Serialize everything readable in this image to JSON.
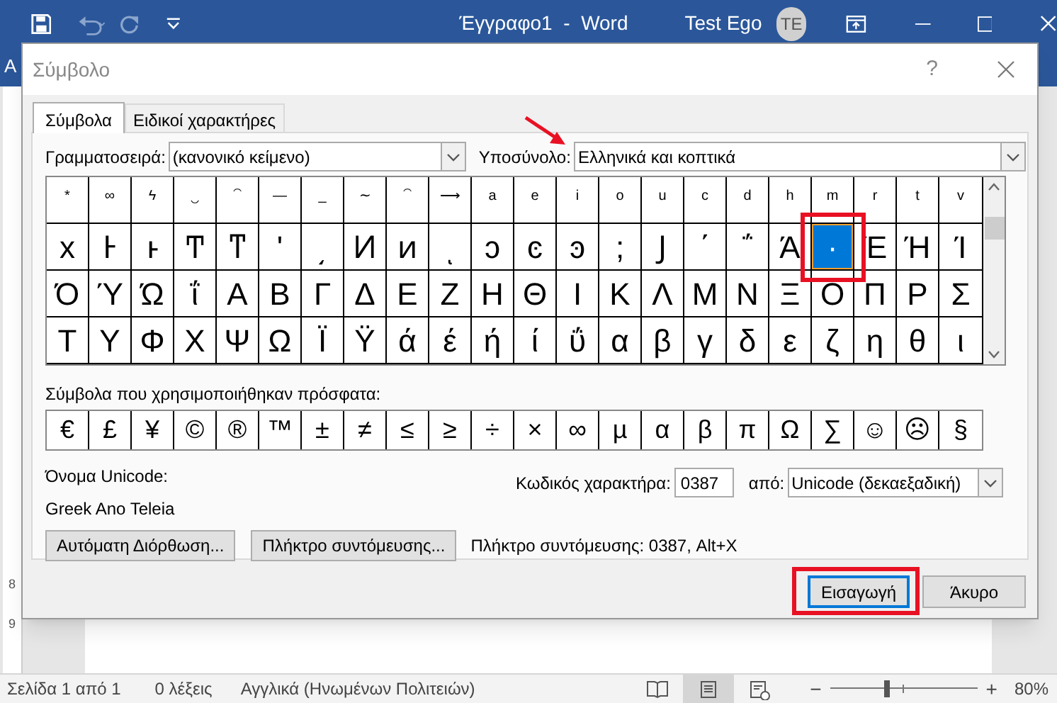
{
  "app": {
    "title": "Έγγραφο1  -  Word",
    "user": "Test Ego",
    "avatar": "TE",
    "ribbon_fragment": "A",
    "ruler_marks": [
      "8",
      "9"
    ]
  },
  "dialog": {
    "title": "Σύμβολο",
    "help": "?",
    "tabs": [
      {
        "label": "Σύμβολα",
        "selected": true
      },
      {
        "label": "Ειδικοί χαρακτήρες",
        "selected": false
      }
    ],
    "font": {
      "label": "Γραμματοσειρά:",
      "value": "(κανονικό κείμενο)"
    },
    "subset": {
      "label": "Υποσύνολο:",
      "value": "Ελληνικά και κοπτικά"
    },
    "grid": {
      "rows": [
        {
          "kind": "marks",
          "cells": [
            {
              "char": "*",
              "selected": false
            },
            {
              "char": "∞",
              "selected": false
            },
            {
              "char": "ϟ",
              "selected": false
            },
            {
              "char": "‿",
              "selected": false
            },
            {
              "char": "⁀",
              "selected": false
            },
            {
              "char": "—",
              "selected": false
            },
            {
              "char": "_",
              "selected": false
            },
            {
              "char": "∼",
              "selected": false
            },
            {
              "char": "⁀",
              "selected": false
            },
            {
              "char": "⟶",
              "selected": false
            },
            {
              "char": "a",
              "selected": false
            },
            {
              "char": "e",
              "selected": false
            },
            {
              "char": "i",
              "selected": false
            },
            {
              "char": "o",
              "selected": false
            },
            {
              "char": "u",
              "selected": false
            },
            {
              "char": "c",
              "selected": false
            },
            {
              "char": "d",
              "selected": false
            },
            {
              "char": "h",
              "selected": false
            },
            {
              "char": "m",
              "selected": false
            },
            {
              "char": "r",
              "selected": false
            },
            {
              "char": "t",
              "selected": false
            },
            {
              "char": "v",
              "selected": false
            }
          ]
        },
        {
          "kind": "chars",
          "cells": [
            {
              "char": "x",
              "selected": false
            },
            {
              "char": "Ͱ",
              "selected": false
            },
            {
              "char": "ͱ",
              "selected": false
            },
            {
              "char": "Ͳ",
              "selected": false
            },
            {
              "char": "ͳ",
              "selected": false
            },
            {
              "char": "ʹ",
              "selected": false
            },
            {
              "char": "͵",
              "selected": false
            },
            {
              "char": "Ͷ",
              "selected": false
            },
            {
              "char": "ͷ",
              "selected": false
            },
            {
              "char": "ͺ",
              "selected": false
            },
            {
              "char": "ͻ",
              "selected": false
            },
            {
              "char": "ͼ",
              "selected": false
            },
            {
              "char": "ͽ",
              "selected": false
            },
            {
              "char": ";",
              "selected": false
            },
            {
              "char": "Ϳ",
              "selected": false
            },
            {
              "char": "΄",
              "selected": false
            },
            {
              "char": "΅",
              "selected": false
            },
            {
              "char": "Ά",
              "selected": false
            },
            {
              "char": "·",
              "selected": true
            },
            {
              "char": "Έ",
              "selected": false
            },
            {
              "char": "Ή",
              "selected": false
            },
            {
              "char": "Ί",
              "selected": false
            }
          ]
        },
        {
          "kind": "chars",
          "cells": [
            {
              "char": "Ό",
              "selected": false
            },
            {
              "char": "Ύ",
              "selected": false
            },
            {
              "char": "Ώ",
              "selected": false
            },
            {
              "char": "ΐ",
              "selected": false
            },
            {
              "char": "Α",
              "selected": false
            },
            {
              "char": "Β",
              "selected": false
            },
            {
              "char": "Γ",
              "selected": false
            },
            {
              "char": "Δ",
              "selected": false
            },
            {
              "char": "Ε",
              "selected": false
            },
            {
              "char": "Ζ",
              "selected": false
            },
            {
              "char": "Η",
              "selected": false
            },
            {
              "char": "Θ",
              "selected": false
            },
            {
              "char": "Ι",
              "selected": false
            },
            {
              "char": "Κ",
              "selected": false
            },
            {
              "char": "Λ",
              "selected": false
            },
            {
              "char": "Μ",
              "selected": false
            },
            {
              "char": "Ν",
              "selected": false
            },
            {
              "char": "Ξ",
              "selected": false
            },
            {
              "char": "Ο",
              "selected": false
            },
            {
              "char": "Π",
              "selected": false
            },
            {
              "char": "Ρ",
              "selected": false
            },
            {
              "char": "Σ",
              "selected": false
            }
          ]
        },
        {
          "kind": "chars",
          "cells": [
            {
              "char": "Τ",
              "selected": false
            },
            {
              "char": "Υ",
              "selected": false
            },
            {
              "char": "Φ",
              "selected": false
            },
            {
              "char": "Χ",
              "selected": false
            },
            {
              "char": "Ψ",
              "selected": false
            },
            {
              "char": "Ω",
              "selected": false
            },
            {
              "char": "Ϊ",
              "selected": false
            },
            {
              "char": "Ϋ",
              "selected": false
            },
            {
              "char": "ά",
              "selected": false
            },
            {
              "char": "έ",
              "selected": false
            },
            {
              "char": "ή",
              "selected": false
            },
            {
              "char": "ί",
              "selected": false
            },
            {
              "char": "ΰ",
              "selected": false
            },
            {
              "char": "α",
              "selected": false
            },
            {
              "char": "β",
              "selected": false
            },
            {
              "char": "γ",
              "selected": false
            },
            {
              "char": "δ",
              "selected": false
            },
            {
              "char": "ε",
              "selected": false
            },
            {
              "char": "ζ",
              "selected": false
            },
            {
              "char": "η",
              "selected": false
            },
            {
              "char": "θ",
              "selected": false
            },
            {
              "char": "ι",
              "selected": false
            }
          ]
        }
      ]
    },
    "recent": {
      "label": "Σύμβολα που χρησιμοποιήθηκαν πρόσφατα:",
      "symbols": [
        "€",
        "£",
        "¥",
        "©",
        "®",
        "™",
        "±",
        "≠",
        "≤",
        "≥",
        "÷",
        "×",
        "∞",
        "µ",
        "α",
        "β",
        "π",
        "Ω",
        "∑",
        "☺",
        "☹",
        "§"
      ]
    },
    "unicode_name": {
      "label": "Όνομα Unicode:",
      "value": "Greek Ano Teleia"
    },
    "char_code": {
      "label": "Κωδικός χαρακτήρα:",
      "value": "0387"
    },
    "from": {
      "label": "από:",
      "value": "Unicode (δεκαεξαδική)"
    },
    "autocorrect_button": "Αυτόματη Διόρθωση...",
    "shortcut_button": "Πλήκτρο συντόμευσης...",
    "shortcut_text": "Πλήκτρο συντόμευσης: 0387, Alt+X",
    "insert_button": "Εισαγωγή",
    "cancel_button": "Άκυρο"
  },
  "status_bar": {
    "page": "Σελίδα 1 από 1",
    "words": "0 λέξεις",
    "language": "Αγγλικά (Ηνωμένων Πολιτειών)",
    "zoom_out": "−",
    "zoom_in": "+",
    "zoom_slider": {
      "level": 0.38
    },
    "zoom": "80%",
    "views": [
      {
        "kind": "read",
        "selected": false
      },
      {
        "kind": "print",
        "selected": true
      },
      {
        "kind": "web",
        "selected": false
      }
    ]
  }
}
